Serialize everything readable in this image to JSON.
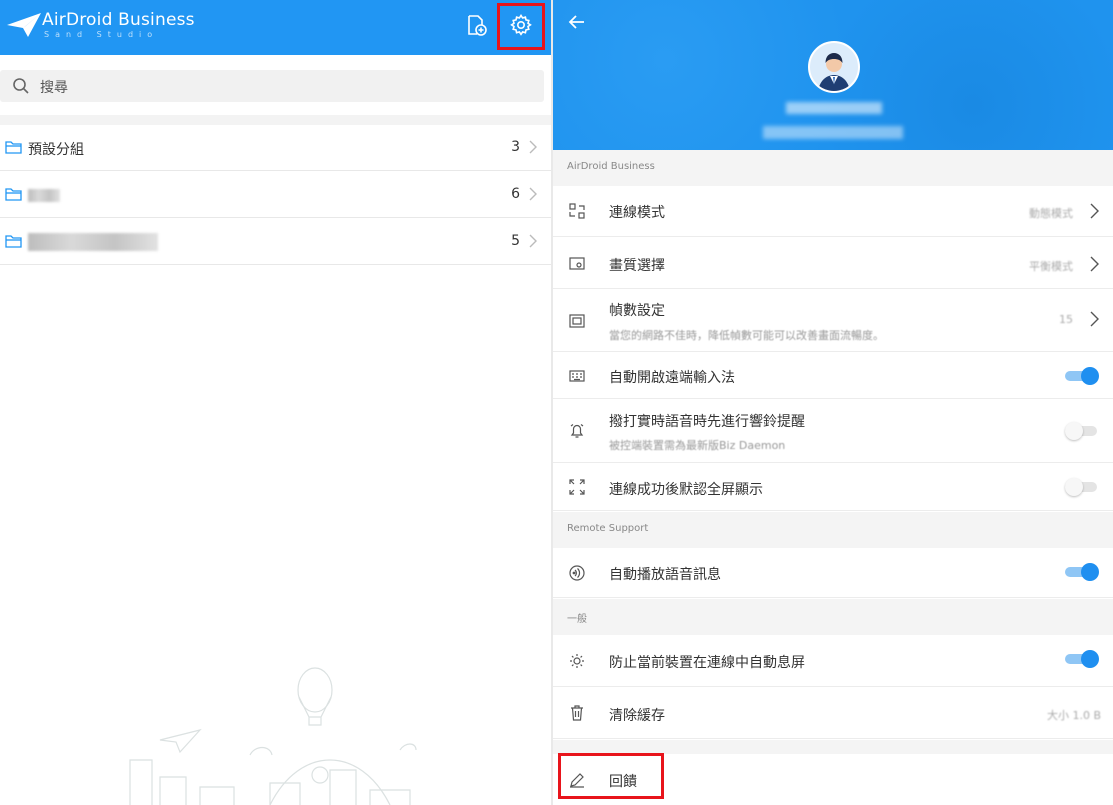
{
  "left": {
    "logo_text": "AirDroid Business",
    "logo_sub": "Sand Studio",
    "search_placeholder": "搜尋",
    "groups": [
      {
        "name": "預設分組",
        "count": "3"
      },
      {
        "name": "",
        "count": "6"
      },
      {
        "name": "",
        "count": "5"
      }
    ]
  },
  "right": {
    "sections": {
      "airdroid": "AirDroid Business",
      "remote": "Remote Support",
      "general": "一般"
    },
    "items": {
      "connection_mode": {
        "label": "連線模式",
        "value": "動態模式"
      },
      "quality": {
        "label": "畫質選擇",
        "value": "平衡模式"
      },
      "fps": {
        "label": "幀數設定",
        "desc": "當您的網路不佳時，降低幀數可能可以改善畫面流暢度。",
        "value": "15"
      },
      "auto_ime": {
        "label": "自動開啟遠端輸入法"
      },
      "ring_alert": {
        "label": "撥打實時語音時先進行響鈴提醒",
        "desc": "被控端裝置需為最新版Biz Daemon"
      },
      "fullscreen": {
        "label": "連線成功後默認全屏顯示"
      },
      "auto_voice": {
        "label": "自動播放語音訊息"
      },
      "keep_awake": {
        "label": "防止當前裝置在連線中自動息屏"
      },
      "clear_cache": {
        "label": "清除緩存",
        "value": "大小 1.0 B"
      },
      "feedback": {
        "label": "回饋"
      }
    }
  },
  "colors": {
    "brand": "#2196f3",
    "highlight": "#e8141b",
    "toggle_on": "#1f8ff0"
  }
}
